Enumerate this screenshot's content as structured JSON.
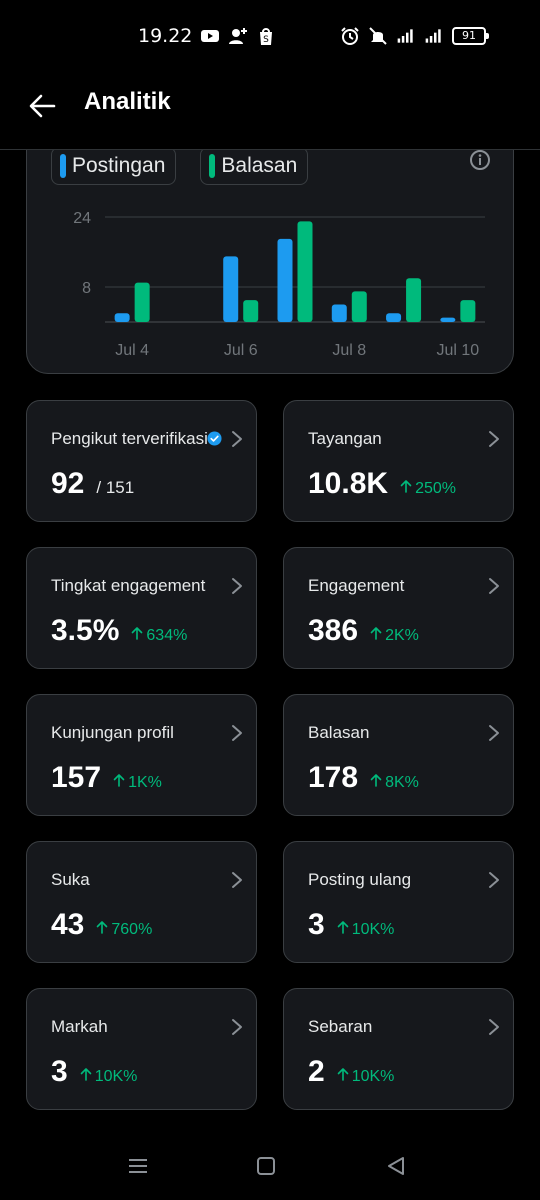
{
  "status_bar": {
    "time": "19.22",
    "battery": "91",
    "network": "4G"
  },
  "header": {
    "title": "Analitik",
    "back_icon": "arrow-left-icon"
  },
  "chart_data": {
    "type": "bar",
    "categories": [
      "Jul 4",
      "Jul 5",
      "Jul 6",
      "Jul 7",
      "Jul 8",
      "Jul 9",
      "Jul 10"
    ],
    "series": [
      {
        "name": "Postingan",
        "color": "#1d9bf0",
        "values": [
          2,
          0,
          15,
          19,
          4,
          2,
          1
        ]
      },
      {
        "name": "Balasan",
        "color": "#00ba7c",
        "values": [
          9,
          0,
          5,
          23,
          7,
          10,
          5
        ]
      }
    ],
    "x_tick_labels": [
      "Jul 4",
      "Jul 6",
      "Jul 8",
      "Jul 10"
    ],
    "y_ticks": [
      8,
      24
    ],
    "ylim": [
      0,
      24
    ],
    "grid": true,
    "legend_position": "top-left"
  },
  "stats": [
    {
      "label": "Pengikut terverifikasi",
      "value": "92",
      "sub": "/ 151",
      "verified": true
    },
    {
      "label": "Tayangan",
      "value": "10.8K",
      "change": "250%"
    },
    {
      "label": "Tingkat engagement",
      "value": "3.5%",
      "change": "634%"
    },
    {
      "label": "Engagement",
      "value": "386",
      "change": "2K%"
    },
    {
      "label": "Kunjungan profil",
      "value": "157",
      "change": "1K%"
    },
    {
      "label": "Balasan",
      "value": "178",
      "change": "8K%"
    },
    {
      "label": "Suka",
      "value": "43",
      "change": "760%"
    },
    {
      "label": "Posting ulang",
      "value": "3",
      "change": "10K%"
    },
    {
      "label": "Markah",
      "value": "3",
      "change": "10K%"
    },
    {
      "label": "Sebaran",
      "value": "2",
      "change": "10K%"
    }
  ],
  "colors": {
    "accent_blue": "#1d9bf0",
    "accent_green": "#00ba7c",
    "card_bg": "#16181c",
    "border": "#3a3e42"
  }
}
